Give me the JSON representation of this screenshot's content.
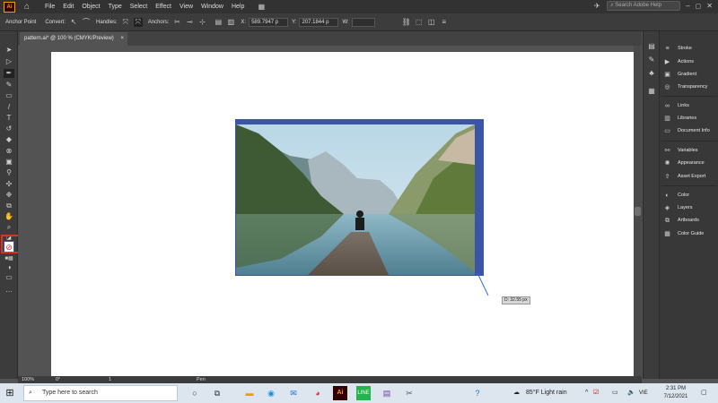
{
  "app": {
    "logo_text": "Ai",
    "menu": [
      "File",
      "Edit",
      "Object",
      "Type",
      "Select",
      "Effect",
      "View",
      "Window",
      "Help"
    ],
    "search_placeholder": "Search Adobe Help"
  },
  "control_bar": {
    "tool_name": "Anchor Point",
    "convert_label": "Convert:",
    "handles_label": "Handles:",
    "anchors_label": "Anchors:",
    "x_label": "X:",
    "x_value": "589.7947 p",
    "y_label": "Y:",
    "y_value": "207.1844 p",
    "w_label": "W:"
  },
  "document": {
    "tab_title": "pattern.ai* @ 100 % (CMYK/Preview)",
    "tab_close": "×"
  },
  "canvas": {
    "distance_tooltip": "D: 32.55 px"
  },
  "right_panel": {
    "items": [
      {
        "label": "Stroke"
      },
      {
        "label": "Actions"
      },
      {
        "label": "Gradient"
      },
      {
        "label": "Transparency"
      },
      {
        "label": "Links"
      },
      {
        "label": "Libraries"
      },
      {
        "label": "Document Info"
      },
      {
        "label": "Variables"
      },
      {
        "label": "Appearance"
      },
      {
        "label": "Asset Export"
      },
      {
        "label": "Color"
      },
      {
        "label": "Layers"
      },
      {
        "label": "Artboards"
      },
      {
        "label": "Color Guide"
      }
    ]
  },
  "status_bar": {
    "zoom": "100%",
    "rotation": "0°",
    "artboard_num": "1",
    "tool": "Pen"
  },
  "taskbar": {
    "search_placeholder": "Type here to search",
    "weather": "85°F  Light rain",
    "lang": "VIE",
    "time": "2:31 PM",
    "date": "7/12/2021"
  }
}
